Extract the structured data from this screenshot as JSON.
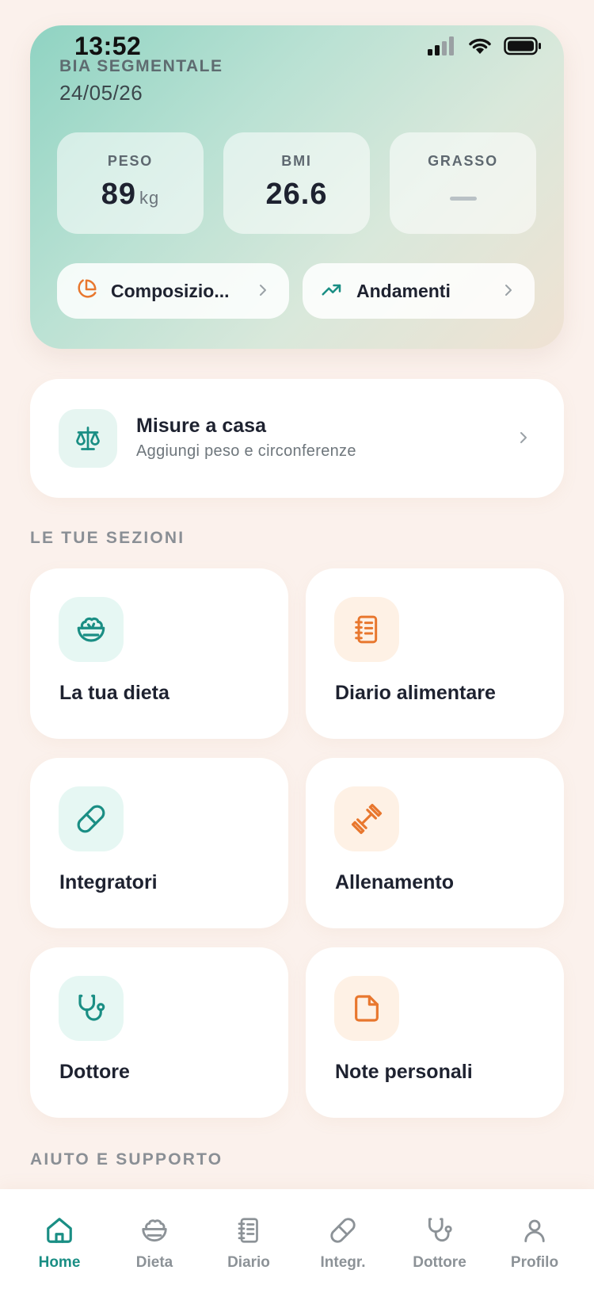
{
  "status_bar": {
    "time": "13:52"
  },
  "hero": {
    "title": "BIA SEGMENTALE",
    "date": "24/05/26",
    "metrics": [
      {
        "label": "PESO",
        "value": "89",
        "unit": "kg"
      },
      {
        "label": "BMI",
        "value": "26.6"
      },
      {
        "label": "GRASSO",
        "value": null
      }
    ],
    "buttons": [
      {
        "label": "Composizio...",
        "icon": "pie-chart-icon"
      },
      {
        "label": "Andamenti",
        "icon": "trending-up-icon"
      }
    ]
  },
  "misure": {
    "title": "Misure a casa",
    "subtitle": "Aggiungi peso e circonferenze",
    "icon": "scale-icon"
  },
  "sections": {
    "title": "LE TUE SEZIONI",
    "items": [
      {
        "label": "La tua dieta",
        "icon": "salad-bowl-icon",
        "color": "teal"
      },
      {
        "label": "Diario alimentare",
        "icon": "notebook-icon",
        "color": "orange"
      },
      {
        "label": "Integratori",
        "icon": "pill-icon",
        "color": "teal"
      },
      {
        "label": "Allenamento",
        "icon": "dumbbell-icon",
        "color": "orange"
      },
      {
        "label": "Dottore",
        "icon": "stethoscope-icon",
        "color": "teal"
      },
      {
        "label": "Note personali",
        "icon": "note-icon",
        "color": "orange"
      }
    ]
  },
  "help": {
    "title": "AIUTO E SUPPORTO"
  },
  "nav": {
    "active": "Home",
    "items": [
      {
        "label": "Home",
        "icon": "home-icon"
      },
      {
        "label": "Dieta",
        "icon": "salad-bowl-icon"
      },
      {
        "label": "Diario",
        "icon": "notebook-icon"
      },
      {
        "label": "Integr.",
        "icon": "pill-icon"
      },
      {
        "label": "Dottore",
        "icon": "stethoscope-icon"
      },
      {
        "label": "Profilo",
        "icon": "user-icon"
      }
    ]
  },
  "colors": {
    "teal": "#1A8E84",
    "orange": "#E8772E",
    "background": "#FBF1EC"
  }
}
